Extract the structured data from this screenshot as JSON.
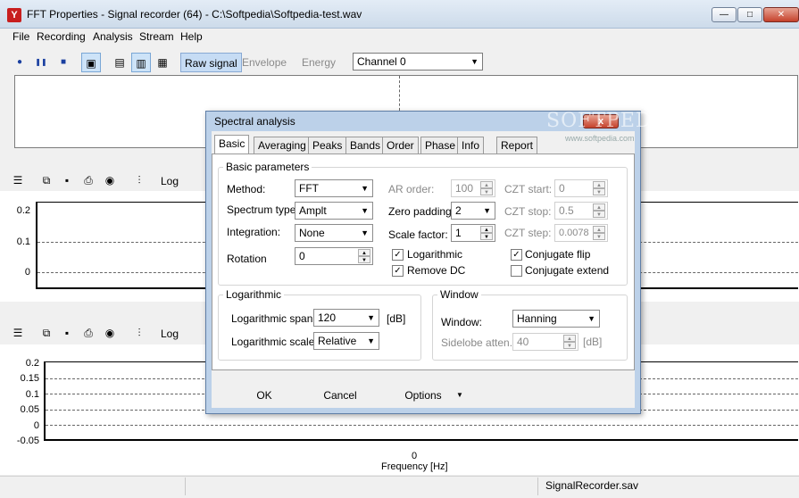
{
  "window": {
    "title": "FFT Properties - Signal recorder (64) - C:\\Softpedia\\Softpedia-test.wav",
    "controls": [
      "—",
      "□",
      "✕"
    ]
  },
  "menu": [
    "File",
    "Recording",
    "Analysis",
    "Stream",
    "Help"
  ],
  "toolbar": {
    "buttons": [
      "●",
      "❚❚",
      "■"
    ],
    "views": [
      "Raw signal",
      "Envelope",
      "Energy"
    ],
    "channel": "Channel 0"
  },
  "panels": {
    "log_label": "Log",
    "mid_ticks": [
      "0.2",
      "0.1",
      "0"
    ],
    "bottom_ticks": [
      "0.2",
      "0.15",
      "0.1",
      "0.05",
      "0",
      "-0.05"
    ],
    "x_tick": "0",
    "x_label": "Frequency [Hz]"
  },
  "status": {
    "file": "SignalRecorder.sav"
  },
  "dialog": {
    "title": "Spectral analysis",
    "close": "x",
    "tabs": [
      "Basic",
      "Averaging",
      "Peaks",
      "Bands",
      "Order",
      "Phase",
      "Info",
      "Report"
    ],
    "basic": {
      "group_title": "Basic parameters",
      "method_label": "Method:",
      "method_value": "FFT",
      "spectrum_label": "Spectrum type:",
      "spectrum_value": "Amplt",
      "integration_label": "Integration:",
      "integration_value": "None",
      "rotation_label": "Rotation",
      "rotation_value": "0",
      "ar_label": "AR order:",
      "ar_value": "100",
      "zero_label": "Zero padding:",
      "zero_value": "2",
      "scale_label": "Scale factor:",
      "scale_value": "1",
      "czt_start_label": "CZT start:",
      "czt_start_value": "0",
      "czt_stop_label": "CZT stop:",
      "czt_stop_value": "0.5",
      "czt_step_label": "CZT step:",
      "czt_step_value": "0.0078",
      "logarithmic_chk": "Logarithmic",
      "remove_dc_chk": "Remove DC",
      "conj_flip_chk": "Conjugate flip",
      "conj_ext_chk": "Conjugate extend",
      "logarithmic_checked": true,
      "remove_dc_checked": true,
      "conj_flip_checked": true,
      "conj_ext_checked": false
    },
    "log_group": {
      "title": "Logarithmic",
      "span_label": "Logarithmic span:",
      "span_value": "120",
      "span_unit": "[dB]",
      "scale_label": "Logarithmic scale:",
      "scale_value": "Relative"
    },
    "window_group": {
      "title": "Window",
      "window_label": "Window:",
      "window_value": "Hanning",
      "sidelobe_label": "Sidelobe atten.:",
      "sidelobe_value": "40",
      "sidelobe_unit": "[dB]"
    },
    "buttons": {
      "ok": "OK",
      "cancel": "Cancel",
      "options": "Options"
    }
  },
  "watermark": "SOFTPEDIA",
  "watermark_small": "www.softpedia.com"
}
